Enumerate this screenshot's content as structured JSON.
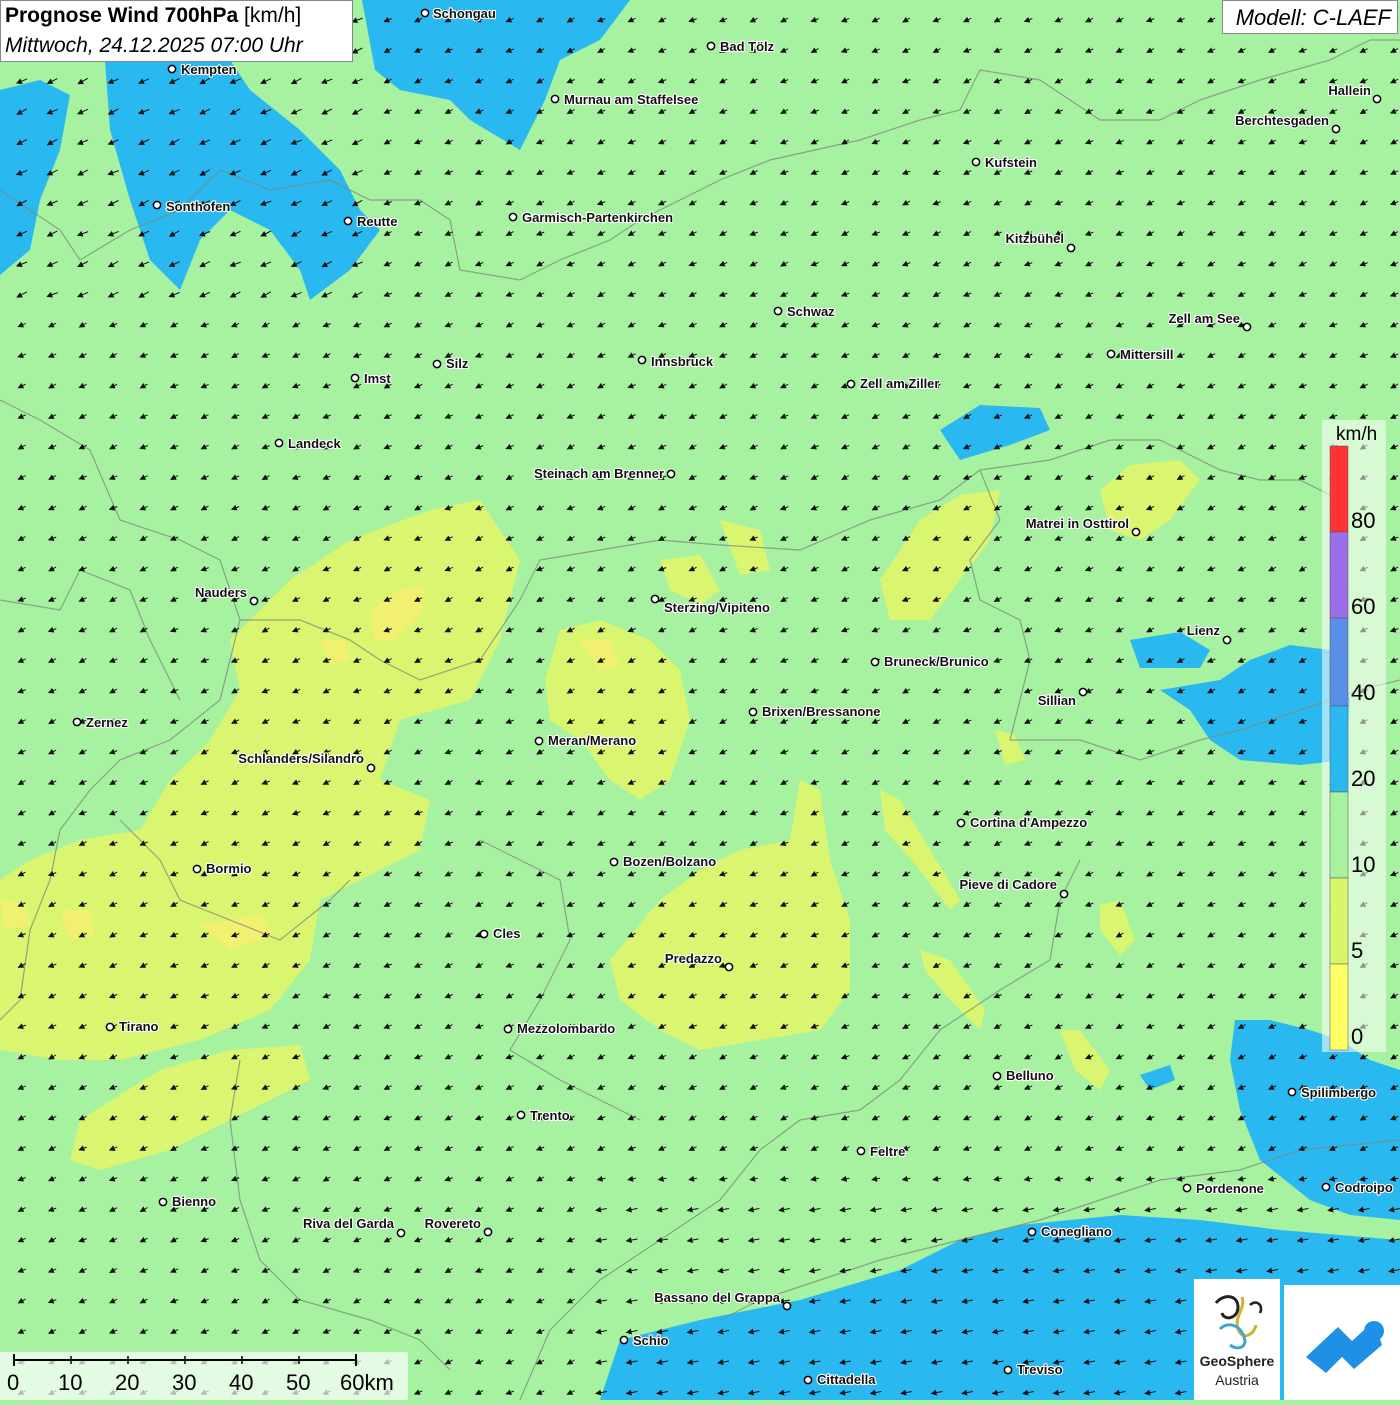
{
  "header": {
    "title_bold": "Prognose Wind 700hPa",
    "title_unit": "[km/h]",
    "subtitle": "Mittwoch, 24.12.2025 07:00 Uhr",
    "model": "Modell: C-LAEF"
  },
  "legend": {
    "unit": "km/h",
    "ticks": [
      "80",
      "60",
      "40",
      "20",
      "10",
      "5",
      "0"
    ],
    "colors": {
      "0": "#ffff66",
      "5": "#d9f56a",
      "10": "#a6f2a0",
      "20": "#2ab8f0",
      "40": "#5a8fe8",
      "60": "#9b6fe8",
      "80": "#ff3333"
    }
  },
  "scalebar": {
    "labels": [
      "0",
      "10",
      "20",
      "30",
      "40",
      "50",
      "60km"
    ]
  },
  "logos": {
    "geosphere_line1": "GeoSphere",
    "geosphere_line2": "Austria"
  },
  "cities": [
    {
      "name": "Schongau",
      "icon": "city-marker-icon"
    },
    {
      "name": "Bad Tölz",
      "icon": "city-marker-icon"
    },
    {
      "name": "Kempten",
      "icon": "city-marker-icon"
    },
    {
      "name": "Murnau am Staffelsee",
      "icon": "city-marker-icon"
    },
    {
      "name": "Hallein",
      "icon": "city-marker-icon"
    },
    {
      "name": "Berchtesgaden",
      "icon": "city-marker-icon"
    },
    {
      "name": "Kufstein",
      "icon": "city-marker-icon"
    },
    {
      "name": "Sonthofen",
      "icon": "city-marker-icon"
    },
    {
      "name": "Reutte",
      "icon": "city-marker-icon"
    },
    {
      "name": "Garmisch-Partenkirchen",
      "icon": "city-marker-icon"
    },
    {
      "name": "Kitzbühel",
      "icon": "city-marker-icon"
    },
    {
      "name": "Schwaz",
      "icon": "city-marker-icon"
    },
    {
      "name": "Zell am See",
      "icon": "city-marker-icon"
    },
    {
      "name": "Mittersill",
      "icon": "city-marker-icon"
    },
    {
      "name": "Innsbruck",
      "icon": "city-marker-icon"
    },
    {
      "name": "Silz",
      "icon": "city-marker-icon"
    },
    {
      "name": "Imst",
      "icon": "city-marker-icon"
    },
    {
      "name": "Zell am Ziller",
      "icon": "city-marker-icon"
    },
    {
      "name": "Landeck",
      "icon": "city-marker-icon"
    },
    {
      "name": "Steinach am Brenner",
      "icon": "city-marker-icon"
    },
    {
      "name": "Matrei in Osttirol",
      "icon": "city-marker-icon"
    },
    {
      "name": "Nauders",
      "icon": "city-marker-icon"
    },
    {
      "name": "Sterzing/Vipiteno",
      "icon": "city-marker-icon"
    },
    {
      "name": "Lienz",
      "icon": "city-marker-icon"
    },
    {
      "name": "Bruneck/Brunico",
      "icon": "city-marker-icon"
    },
    {
      "name": "Sillian",
      "icon": "city-marker-icon"
    },
    {
      "name": "Brixen/Bressanone",
      "icon": "city-marker-icon"
    },
    {
      "name": "Zernez",
      "icon": "city-marker-icon"
    },
    {
      "name": "Meran/Merano",
      "icon": "city-marker-icon"
    },
    {
      "name": "Schlanders/Silandro",
      "icon": "city-marker-icon"
    },
    {
      "name": "Cortina d'Ampezzo",
      "icon": "city-marker-icon"
    },
    {
      "name": "Bozen/Bolzano",
      "icon": "city-marker-icon"
    },
    {
      "name": "Bormio",
      "icon": "city-marker-icon"
    },
    {
      "name": "Pieve di Cadore",
      "icon": "city-marker-icon"
    },
    {
      "name": "Cles",
      "icon": "city-marker-icon"
    },
    {
      "name": "Predazzo",
      "icon": "city-marker-icon"
    },
    {
      "name": "Tirano",
      "icon": "city-marker-icon"
    },
    {
      "name": "Mezzolombardo",
      "icon": "city-marker-icon"
    },
    {
      "name": "Belluno",
      "icon": "city-marker-icon"
    },
    {
      "name": "Spilimbergo",
      "icon": "city-marker-icon"
    },
    {
      "name": "Trento",
      "icon": "city-marker-icon"
    },
    {
      "name": "Feltre",
      "icon": "city-marker-icon"
    },
    {
      "name": "Pordenone",
      "icon": "city-marker-icon"
    },
    {
      "name": "Codroipo",
      "icon": "city-marker-icon"
    },
    {
      "name": "Bienno",
      "icon": "city-marker-icon"
    },
    {
      "name": "Riva del Garda",
      "icon": "city-marker-icon"
    },
    {
      "name": "Rovereto",
      "icon": "city-marker-icon"
    },
    {
      "name": "Conegliano",
      "icon": "city-marker-icon"
    },
    {
      "name": "Bassano del Grappa",
      "icon": "city-marker-icon"
    },
    {
      "name": "Schio",
      "icon": "city-marker-icon"
    },
    {
      "name": "Treviso",
      "icon": "city-marker-icon"
    },
    {
      "name": "Cittadella",
      "icon": "city-marker-icon"
    }
  ],
  "wind_arrow_icon": "wind-arrow-icon"
}
